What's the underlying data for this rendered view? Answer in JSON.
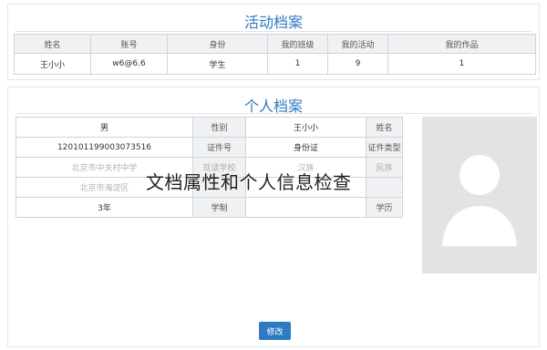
{
  "activity": {
    "title": "活动档案",
    "headers": [
      "姓名",
      "账号",
      "身份",
      "我的班级",
      "我的活动",
      "我的作品"
    ],
    "rows": [
      [
        "王小小",
        "w6@6.6",
        "学生",
        "1",
        "9",
        "1"
      ]
    ]
  },
  "profile": {
    "title": "个人档案",
    "fields": {
      "name_label": "姓名",
      "name": "王小小",
      "gender_label": "性别",
      "gender": "男",
      "id_type_label": "证件类型",
      "id_type": "身份证",
      "id_no_label": "证件号",
      "id_no": "120101199003073516",
      "ethnic_label": "民族",
      "ethnic": "汉族",
      "school_label": "就读学校",
      "school": "北京市中关村中学",
      "area_label": "北京市海淀区",
      "edu_label": "学历",
      "edu": "3年",
      "grade_label": "学制"
    },
    "photo": "avatar-placeholder",
    "edit_button": "修改"
  },
  "overlay_caption": "文档属性和个人信息检查",
  "colors": {
    "accent": "#2e7bc2",
    "header_bg": "#f0f1f3",
    "border": "#cfd5db",
    "photo_bg": "#e3e3e3"
  }
}
